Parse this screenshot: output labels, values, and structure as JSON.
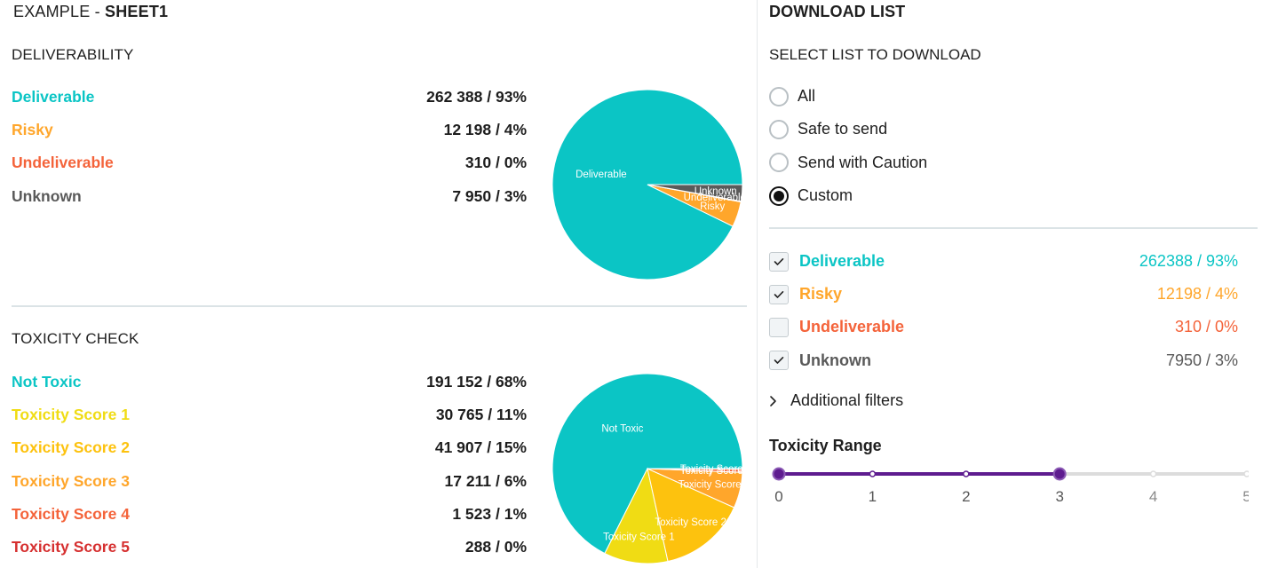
{
  "sheet": {
    "prefix": "EXAMPLE - ",
    "name": "SHEET1"
  },
  "deliverability": {
    "title": "DELIVERABILITY",
    "items": [
      {
        "label": "Deliverable",
        "value": "262 388 / 93%",
        "count": 262388,
        "color": "#0bc5c5"
      },
      {
        "label": "Risky",
        "value": "12 198 / 4%",
        "count": 12198,
        "color": "#ffa62b"
      },
      {
        "label": "Undeliverable",
        "value": "310 / 0%",
        "count": 310,
        "color": "#f4633a"
      },
      {
        "label": "Unknown",
        "value": "7 950 / 3%",
        "count": 7950,
        "color": "#5a5a5a"
      }
    ]
  },
  "toxicity": {
    "title": "TOXICITY CHECK",
    "items": [
      {
        "label": "Not Toxic",
        "value": "191 152 / 68%",
        "count": 191152,
        "color": "#0bc5c5"
      },
      {
        "label": "Toxicity Score 1",
        "value": "30 765 / 11%",
        "count": 30765,
        "color": "#f0dc14"
      },
      {
        "label": "Toxicity Score 2",
        "value": "41 907 / 15%",
        "count": 41907,
        "color": "#fdc20e"
      },
      {
        "label": "Toxicity Score 3",
        "value": "17 211 / 6%",
        "count": 17211,
        "color": "#ffa62b"
      },
      {
        "label": "Toxicity Score 4",
        "value": "1 523 / 1%",
        "count": 1523,
        "color": "#f4633a"
      },
      {
        "label": "Toxicity Score 5",
        "value": "288 / 0%",
        "count": 288,
        "color": "#d63030"
      }
    ]
  },
  "download": {
    "title": "DOWNLOAD LIST",
    "subtitle": "SELECT LIST TO DOWNLOAD",
    "options": [
      {
        "label": "All",
        "selected": false
      },
      {
        "label": "Safe to send",
        "selected": false
      },
      {
        "label": "Send with Caution",
        "selected": false
      },
      {
        "label": "Custom",
        "selected": true
      }
    ],
    "checks": [
      {
        "label": "Deliverable",
        "value": "262388 / 93%",
        "checked": true,
        "color": "#0bc5c5"
      },
      {
        "label": "Risky",
        "value": "12198 / 4%",
        "checked": true,
        "color": "#ffa62b"
      },
      {
        "label": "Undeliverable",
        "value": "310 / 0%",
        "checked": false,
        "color": "#f4633a"
      },
      {
        "label": "Unknown",
        "value": "7950 / 3%",
        "checked": true,
        "color": "#5a5a5a"
      }
    ],
    "filters_label": "Additional filters",
    "range": {
      "title": "Toxicity Range",
      "ticks": [
        "0",
        "1",
        "2",
        "3",
        "4",
        "5"
      ],
      "min": 0,
      "max": 3,
      "color": "#5e1c8f"
    }
  },
  "icons": {
    "filters": "chevron-right-icon",
    "check": "checkmark-icon"
  }
}
